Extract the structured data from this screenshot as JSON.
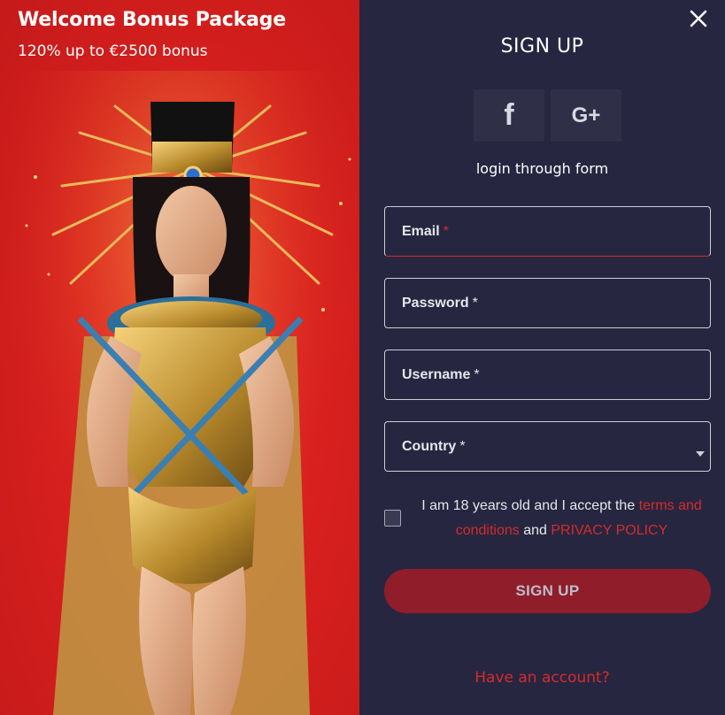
{
  "promo": {
    "title": "Welcome Bonus Package",
    "subtitle": "120% up to €2500 bonus",
    "background_color": "#d8201e"
  },
  "signup": {
    "title": "SIGN UP",
    "social": [
      {
        "name": "facebook",
        "glyph": "f"
      },
      {
        "name": "google-plus",
        "glyph": "G+"
      }
    ],
    "login_text": "login through form",
    "fields": {
      "email": {
        "label": "Email",
        "required_mark": "*",
        "value": ""
      },
      "password": {
        "label": "Password",
        "required_mark": "*",
        "value": ""
      },
      "username": {
        "label": "Username",
        "required_mark": "*",
        "value": ""
      },
      "country": {
        "label": "Country",
        "required_mark": "*",
        "value": ""
      }
    },
    "terms": {
      "prefix": "I am 18 years old and I accept the",
      "terms_link": "terms and conditions",
      "joiner": "and",
      "privacy_link": "PRIVACY POLICY",
      "checked": false
    },
    "submit_label": "SIGN UP",
    "have_account": "Have an account?",
    "close_icon": "close-icon"
  },
  "colors": {
    "panel_bg": "#262640",
    "accent_red": "#d62b2b",
    "button_bg": "#8f1e2a",
    "social_bg": "#2f2f48"
  }
}
